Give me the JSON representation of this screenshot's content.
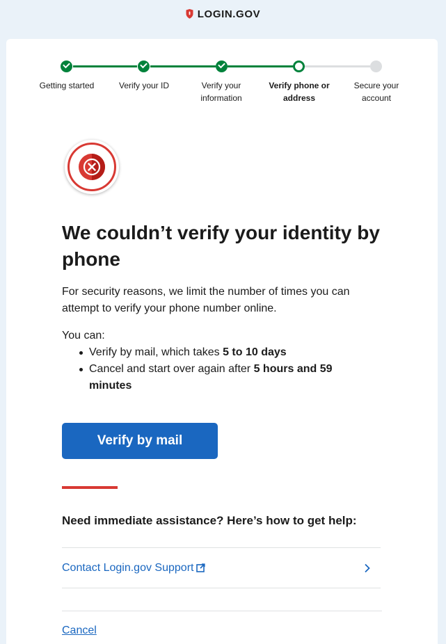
{
  "header": {
    "logo_text": "LOGIN.GOV"
  },
  "steps": [
    {
      "label": "Getting started",
      "status": "complete"
    },
    {
      "label": "Verify your ID",
      "status": "complete"
    },
    {
      "label": "Verify your information",
      "status": "complete"
    },
    {
      "label": "Verify phone or address",
      "status": "current"
    },
    {
      "label": "Secure your account",
      "status": "incomplete"
    }
  ],
  "main": {
    "title": "We couldn’t verify your identity by phone",
    "intro": "For security reasons, we limit the number of times you can attempt to verify your phone number online.",
    "you_can": "You can:",
    "options": [
      {
        "text": "Verify by mail, which takes ",
        "bold": "5 to 10 days"
      },
      {
        "text": "Cancel and start over again after ",
        "bold": "5 hours and 59 minutes"
      }
    ],
    "primary_button": "Verify by mail"
  },
  "help": {
    "heading": "Need immediate assistance? Here’s how to get help:",
    "link_label": "Contact Login.gov Support"
  },
  "cancel_label": "Cancel",
  "colors": {
    "accent": "#1a67c0",
    "success": "#00823b",
    "error": "#d83933",
    "page_bg": "#eaf2f9"
  }
}
